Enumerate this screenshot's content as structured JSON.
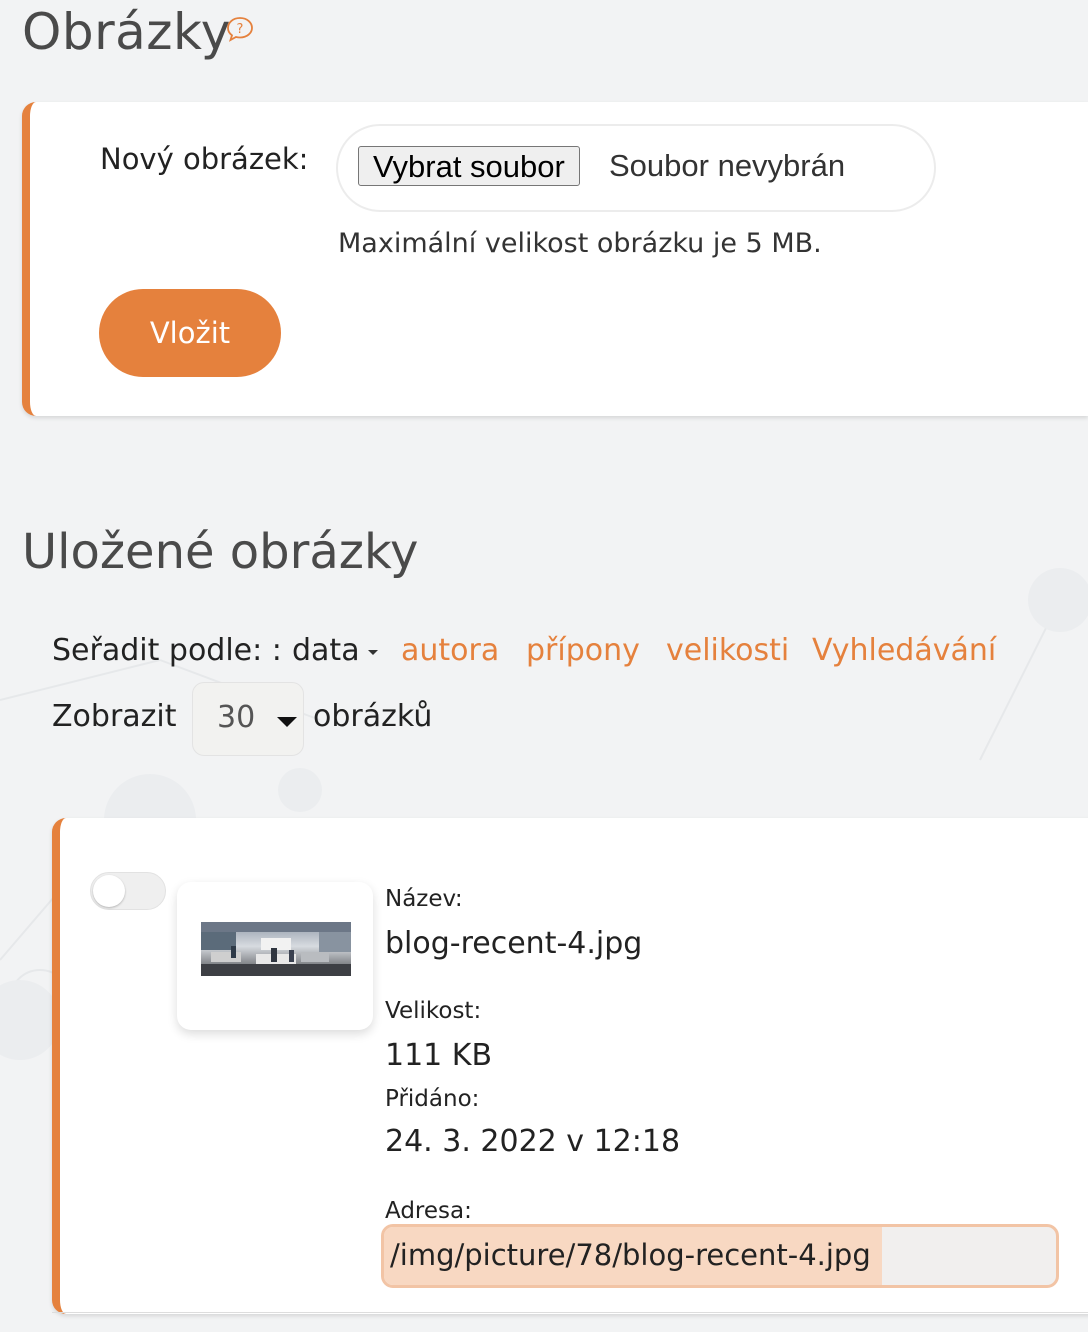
{
  "header": {
    "title": "Obrázky",
    "help_icon": "help-bubble-icon"
  },
  "upload": {
    "label": "Nový obrázek:",
    "choose_button": "Vybrat soubor",
    "file_status": "Soubor nevybrán",
    "max_size_note": "Maximální velikost obrázku je 5 MB.",
    "submit_label": "Vložit"
  },
  "saved": {
    "title": "Uložené obrázky",
    "sort": {
      "label": "Seřadit podle: :",
      "current": "data",
      "options": [
        "autora",
        "přípony",
        "velikosti",
        "Vyhledávání"
      ]
    },
    "show": {
      "prefix": "Zobrazit",
      "per_page": "30",
      "suffix": "obrázků"
    },
    "items": [
      {
        "name_label": "Název:",
        "name": "blog-recent-4.jpg",
        "size_label": "Velikost:",
        "size": "111 KB",
        "added_label": "Přidáno:",
        "added": "24. 3. 2022 v 12:18",
        "address_label": "Adresa:",
        "address": "/img/picture/78/blog-recent-4.jpg",
        "selected": false
      }
    ]
  },
  "colors": {
    "accent": "#e5813d",
    "background": "#f2f3f4",
    "card": "#ffffff",
    "selection": "#f8d8c2"
  }
}
